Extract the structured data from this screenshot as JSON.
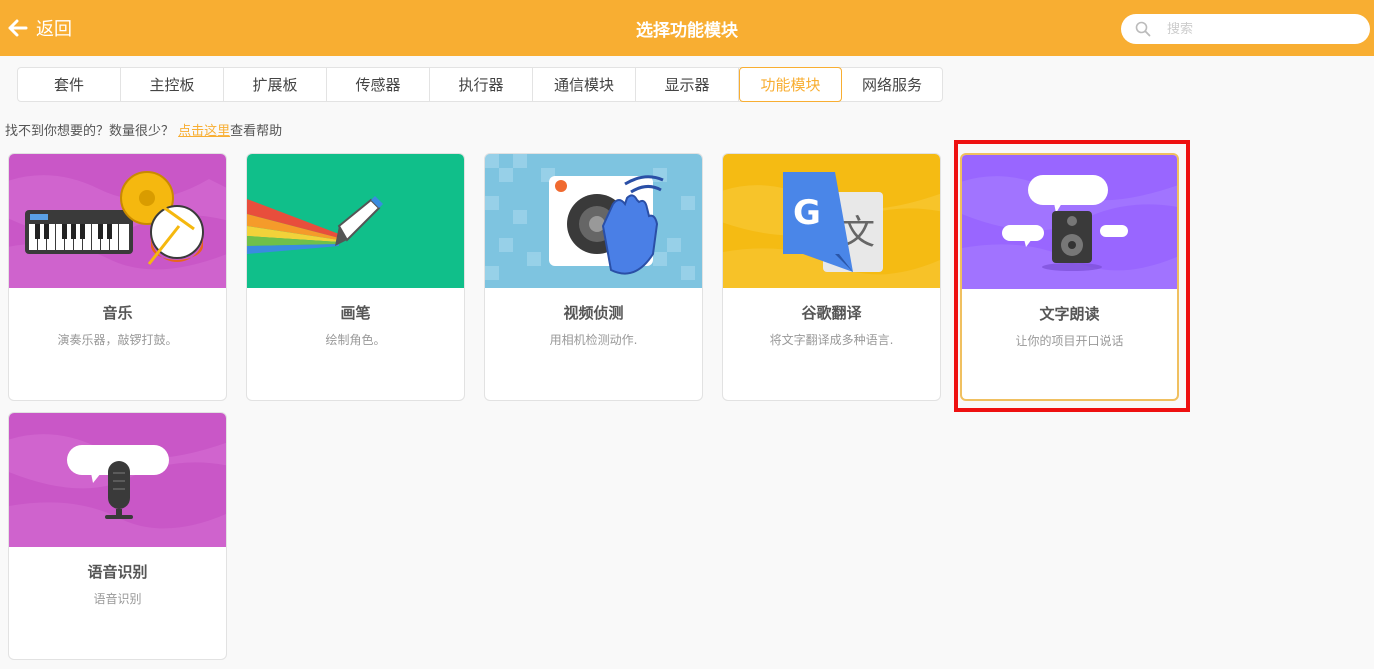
{
  "header": {
    "back_label": "返回",
    "title": "选择功能模块",
    "search_placeholder": "搜索"
  },
  "tabs": [
    {
      "label": "套件"
    },
    {
      "label": "主控板"
    },
    {
      "label": "扩展板"
    },
    {
      "label": "传感器"
    },
    {
      "label": "执行器"
    },
    {
      "label": "通信模块"
    },
    {
      "label": "显示器"
    },
    {
      "label": "功能模块",
      "active": true
    },
    {
      "label": "网络服务"
    }
  ],
  "help": {
    "prefix": "找不到你想要的？数量很少？ ",
    "link": "点击这里",
    "suffix": "查看帮助"
  },
  "cards": [
    {
      "name": "音乐",
      "desc": "演奏乐器，敲锣打鼓。"
    },
    {
      "name": "画笔",
      "desc": "绘制角色。"
    },
    {
      "name": "视频侦测",
      "desc": "用相机检测动作."
    },
    {
      "name": "谷歌翻译",
      "desc": "将文字翻译成多种语言."
    },
    {
      "name": "文字朗读",
      "desc": "让你的项目开口说话",
      "selected": true
    },
    {
      "name": "语音识别",
      "desc": "语音识别"
    }
  ],
  "colors": {
    "accent": "#f8ae32",
    "highlight": "#ee1111",
    "music_bg": "#c957c7",
    "pen_bg": "#10bf8a",
    "video_bg": "#7ec4e0",
    "translate_bg": "#f5bb13",
    "tts_bg": "#9966ff",
    "speech_bg": "#c957c7"
  },
  "icons": {
    "back": "arrow-left-icon",
    "search": "search-icon"
  }
}
